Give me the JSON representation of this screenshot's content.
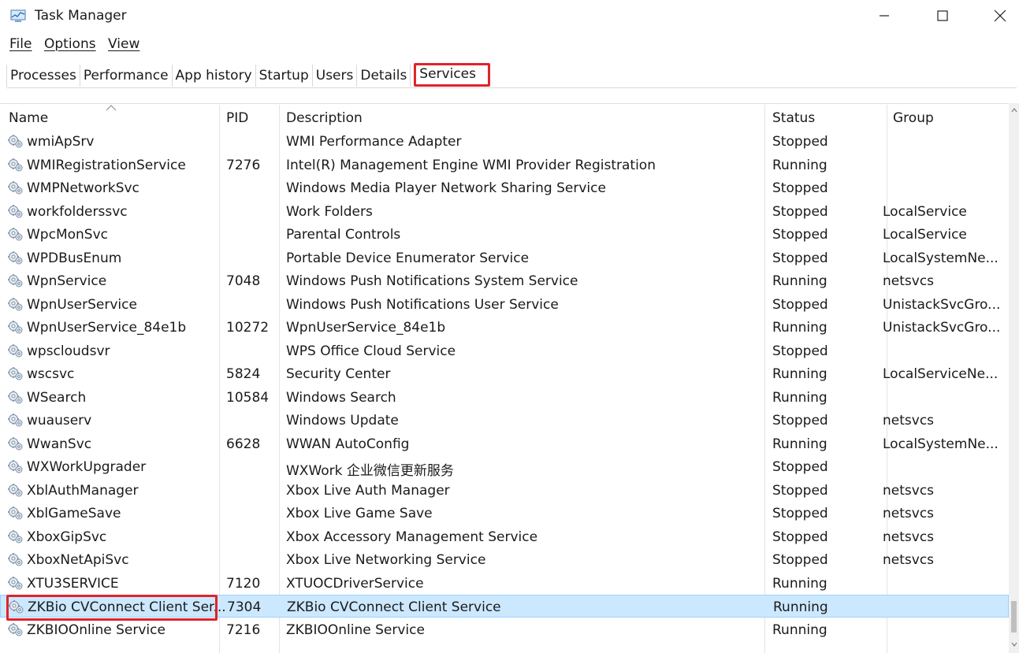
{
  "window": {
    "title": "Task Manager"
  },
  "menu": {
    "file": "File",
    "options": "Options",
    "view": "View"
  },
  "tabs": [
    {
      "label": "Processes"
    },
    {
      "label": "Performance"
    },
    {
      "label": "App history"
    },
    {
      "label": "Startup"
    },
    {
      "label": "Users"
    },
    {
      "label": "Details"
    },
    {
      "label": "Services"
    }
  ],
  "active_tab": "Services",
  "columns": {
    "name": "Name",
    "pid": "PID",
    "description": "Description",
    "status": "Status",
    "group": "Group"
  },
  "rows": [
    {
      "name": "wmiApSrv",
      "pid": "",
      "description": "WMI Performance Adapter",
      "status": "Stopped",
      "group": ""
    },
    {
      "name": "WMIRegistrationService",
      "pid": "7276",
      "description": "Intel(R) Management Engine WMI Provider Registration",
      "status": "Running",
      "group": ""
    },
    {
      "name": "WMPNetworkSvc",
      "pid": "",
      "description": "Windows Media Player Network Sharing Service",
      "status": "Stopped",
      "group": ""
    },
    {
      "name": "workfolderssvc",
      "pid": "",
      "description": "Work Folders",
      "status": "Stopped",
      "group": "LocalService"
    },
    {
      "name": "WpcMonSvc",
      "pid": "",
      "description": "Parental Controls",
      "status": "Stopped",
      "group": "LocalService"
    },
    {
      "name": "WPDBusEnum",
      "pid": "",
      "description": "Portable Device Enumerator Service",
      "status": "Stopped",
      "group": "LocalSystemNe..."
    },
    {
      "name": "WpnService",
      "pid": "7048",
      "description": "Windows Push Notifications System Service",
      "status": "Running",
      "group": "netsvcs"
    },
    {
      "name": "WpnUserService",
      "pid": "",
      "description": "Windows Push Notifications User Service",
      "status": "Stopped",
      "group": "UnistackSvcGro..."
    },
    {
      "name": "WpnUserService_84e1b",
      "pid": "10272",
      "description": "WpnUserService_84e1b",
      "status": "Running",
      "group": "UnistackSvcGro..."
    },
    {
      "name": "wpscloudsvr",
      "pid": "",
      "description": "WPS Office Cloud Service",
      "status": "Stopped",
      "group": ""
    },
    {
      "name": "wscsvc",
      "pid": "5824",
      "description": "Security Center",
      "status": "Running",
      "group": "LocalServiceNe..."
    },
    {
      "name": "WSearch",
      "pid": "10584",
      "description": "Windows Search",
      "status": "Running",
      "group": ""
    },
    {
      "name": "wuauserv",
      "pid": "",
      "description": "Windows Update",
      "status": "Stopped",
      "group": "netsvcs"
    },
    {
      "name": "WwanSvc",
      "pid": "6628",
      "description": "WWAN AutoConfig",
      "status": "Running",
      "group": "LocalSystemNe..."
    },
    {
      "name": "WXWorkUpgrader",
      "pid": "",
      "description": "WXWork 企业微信更新服务",
      "status": "Stopped",
      "group": ""
    },
    {
      "name": "XblAuthManager",
      "pid": "",
      "description": "Xbox Live Auth Manager",
      "status": "Stopped",
      "group": "netsvcs"
    },
    {
      "name": "XblGameSave",
      "pid": "",
      "description": "Xbox Live Game Save",
      "status": "Stopped",
      "group": "netsvcs"
    },
    {
      "name": "XboxGipSvc",
      "pid": "",
      "description": "Xbox Accessory Management Service",
      "status": "Stopped",
      "group": "netsvcs"
    },
    {
      "name": "XboxNetApiSvc",
      "pid": "",
      "description": "Xbox Live Networking Service",
      "status": "Stopped",
      "group": "netsvcs"
    },
    {
      "name": "XTU3SERVICE",
      "pid": "7120",
      "description": "XTUOCDriverService",
      "status": "Running",
      "group": ""
    },
    {
      "name": "ZKBio CVConnect Client Ser...",
      "pid": "7304",
      "description": "ZKBio CVConnect Client Service",
      "status": "Running",
      "group": "",
      "selected": true
    },
    {
      "name": "ZKBIOOnline Service",
      "pid": "7216",
      "description": "ZKBIOOnline Service",
      "status": "Running",
      "group": ""
    }
  ],
  "icons": {
    "app": "task-manager-icon",
    "row": "service-gear-icon",
    "minimize": "minimize-icon",
    "maximize": "maximize-icon",
    "close": "close-icon",
    "sort": "sort-ascending-icon"
  },
  "colors": {
    "highlight": "#e0242a",
    "selection": "#cce8ff"
  }
}
